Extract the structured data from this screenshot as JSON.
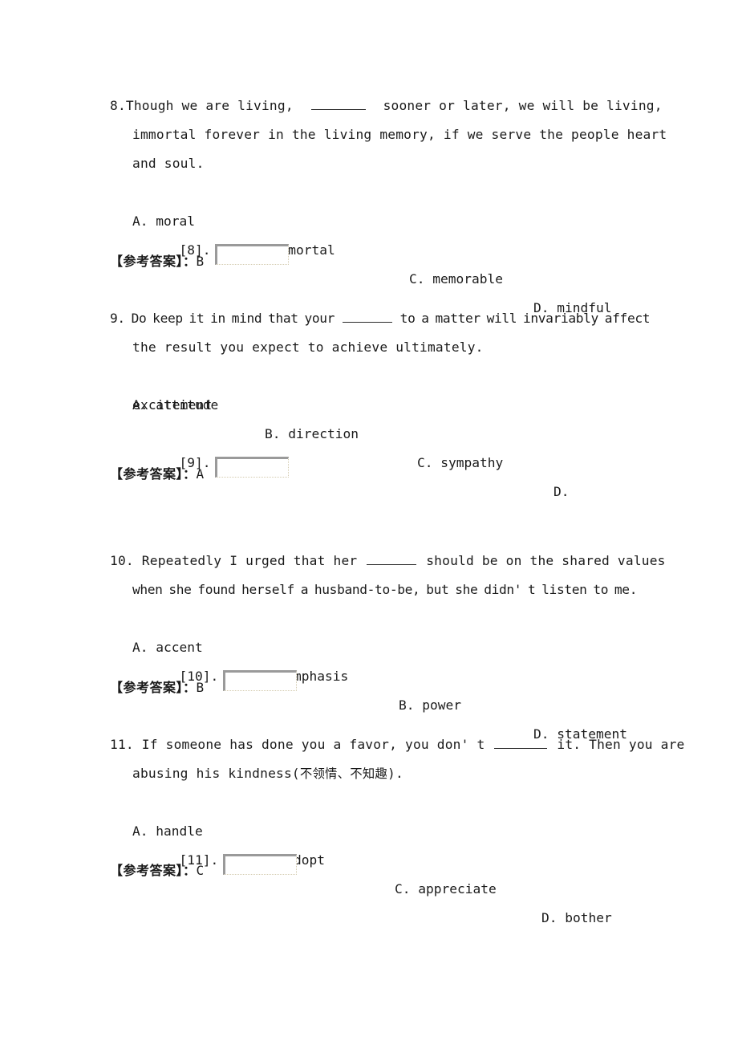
{
  "document": {
    "type": "english-multiple-choice-worksheet",
    "reference_answer_label": "【参考答案】：",
    "blank_marker": "________"
  },
  "questions": [
    {
      "number": "8.",
      "lines": [
        "Though we are living,  ",
        "immortal forever in the living memory, if we serve the people heart",
        "and soul."
      ],
      "line1_after_blank": "  sooner or later, we will be living,",
      "options": [
        {
          "letter": "A.",
          "text": "moral"
        },
        {
          "letter": "B.",
          "text": "mortal"
        },
        {
          "letter": "C.",
          "text": "memorable"
        },
        {
          "letter": "D.",
          "text": "mindful"
        }
      ],
      "answer_field_label": "[8].",
      "answer_field_value": "",
      "reference_answer": "B"
    },
    {
      "number": "9.",
      "lines": [
        "Do keep it in mind that your ",
        "the result you expect to achieve ultimately.",
        "excitement"
      ],
      "line1_after_blank": " to a matter will invariably affect",
      "options": [
        {
          "letter": "A.",
          "text": "attitude"
        },
        {
          "letter": "B.",
          "text": "direction"
        },
        {
          "letter": "C.",
          "text": "sympathy"
        },
        {
          "letter": "D.",
          "text": ""
        }
      ],
      "answer_field_label": "[9].",
      "answer_field_value": "",
      "reference_answer": "A"
    },
    {
      "number": "10.",
      "lines": [
        "Repeatedly I urged that her ",
        "when she found herself a husband-to-be, but she didn' t listen to me."
      ],
      "line1_after_blank": " should be on the shared values",
      "options": [
        {
          "letter": "A.",
          "text": "accent"
        },
        {
          "letter": "B.",
          "text": "emphasis"
        },
        {
          "letter": "B.",
          "text": "power"
        },
        {
          "letter": "D.",
          "text": "statement"
        }
      ],
      "answer_field_label": "[10].",
      "answer_field_value": "",
      "reference_answer": "B"
    },
    {
      "number": "11.",
      "lines": [
        "If someone has done you a favor, you don' t ",
        "abusing his kindness(不领情、不知趣)."
      ],
      "line1_after_blank": " it. Then you are",
      "line2_prefix": "abusing his kindness(",
      "line2_cn": "不领情、不知趣",
      "line2_suffix": ").",
      "options": [
        {
          "letter": "A.",
          "text": "handle"
        },
        {
          "letter": "B.",
          "text": "adopt"
        },
        {
          "letter": "C.",
          "text": "appreciate"
        },
        {
          "letter": "D.",
          "text": "bother"
        }
      ],
      "answer_field_label": "[11].",
      "answer_field_value": "",
      "reference_answer": "C"
    }
  ]
}
